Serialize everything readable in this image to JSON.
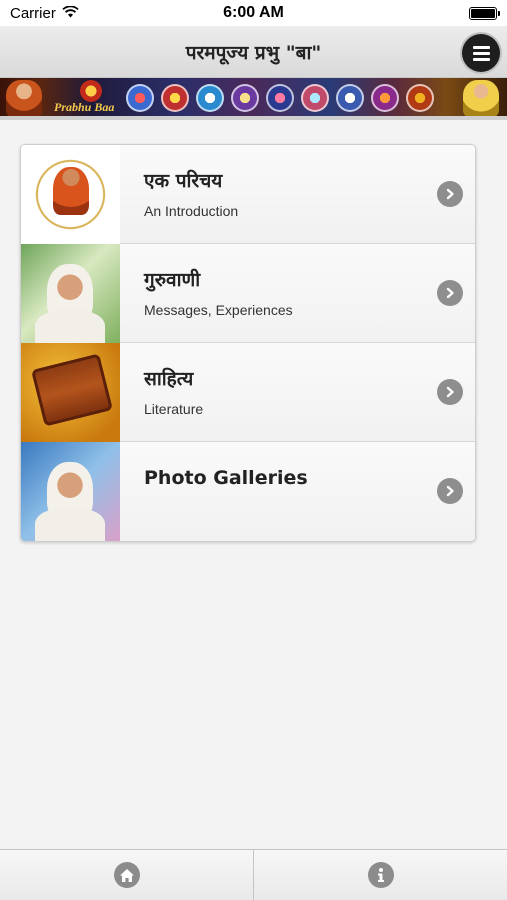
{
  "status_bar": {
    "carrier": "Carrier",
    "time": "6:00 AM"
  },
  "header": {
    "title": "परमपूज्य प्रभु \"बा\"",
    "menu_icon": "hamburger-menu-icon"
  },
  "banner": {
    "logo_text": "Prabhu Baa"
  },
  "menu_list": [
    {
      "title": "एक परिचय",
      "subtitle": "An Introduction",
      "thumbnail": "guru-portrait-thumbnail"
    },
    {
      "title": "गुरुवाणी",
      "subtitle": "Messages, Experiences",
      "thumbnail": "baa-portrait-thumbnail"
    },
    {
      "title": "साहित्य",
      "subtitle": "Literature",
      "thumbnail": "literature-scroll-thumbnail"
    },
    {
      "title": "Photo Galleries",
      "subtitle": "",
      "thumbnail": "gallery-portrait-thumbnail"
    }
  ],
  "tab_bar": {
    "tabs": [
      {
        "icon": "home-icon"
      },
      {
        "icon": "info-icon"
      }
    ]
  },
  "colors": {
    "header_bg": "#dedede",
    "menu_button": "#1e1e1e",
    "chevron": "#8e8e8e",
    "page_bg": "#f3f3f3"
  }
}
